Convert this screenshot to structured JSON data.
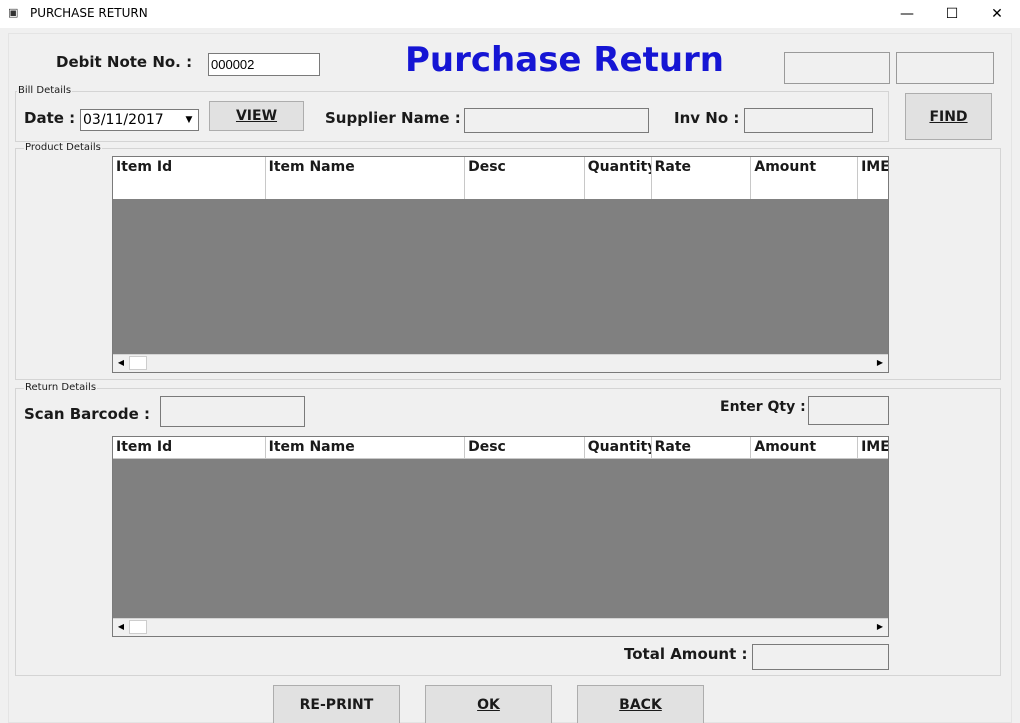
{
  "window": {
    "title": "PURCHASE RETURN",
    "minimize_glyph": "—",
    "maximize_glyph": "☐",
    "close_glyph": "✕"
  },
  "header": {
    "debit_note_label": "Debit Note No. :",
    "debit_note_value": "000002",
    "page_title": "Purchase Return"
  },
  "bill_details": {
    "group_label": "Bill Details",
    "date_label": "Date :",
    "date_value": "03/11/2017",
    "view_button": "VIEW",
    "supplier_label": "Supplier Name :",
    "supplier_value": "",
    "inv_label": "Inv No :",
    "inv_value": "",
    "find_button": "FIND"
  },
  "product_details": {
    "group_label": "Product Details",
    "columns": [
      "Item Id",
      "Item Name",
      "Desc",
      "Quantity",
      "Rate",
      "Amount",
      "IME"
    ]
  },
  "return_details": {
    "group_label": "Return Details",
    "scan_label": "Scan Barcode :",
    "scan_value": "",
    "qty_label": "Enter Qty :",
    "qty_value": "",
    "columns": [
      "Item Id",
      "Item Name",
      "Desc",
      "Quantity",
      "Rate",
      "Amount",
      "IME"
    ],
    "total_label": "Total Amount :",
    "total_value": ""
  },
  "footer": {
    "reprint_button": "RE-PRINT",
    "ok_button": "OK",
    "back_button": "BACK"
  },
  "colors": {
    "title_blue": "#1515d4",
    "grid_background": "#808080",
    "form_background": "#f0f0f0"
  },
  "icons": {
    "app": "form-icon",
    "dropdown": "chevron-down-icon",
    "scroll_left": "arrow-left-icon",
    "scroll_right": "arrow-right-icon"
  }
}
